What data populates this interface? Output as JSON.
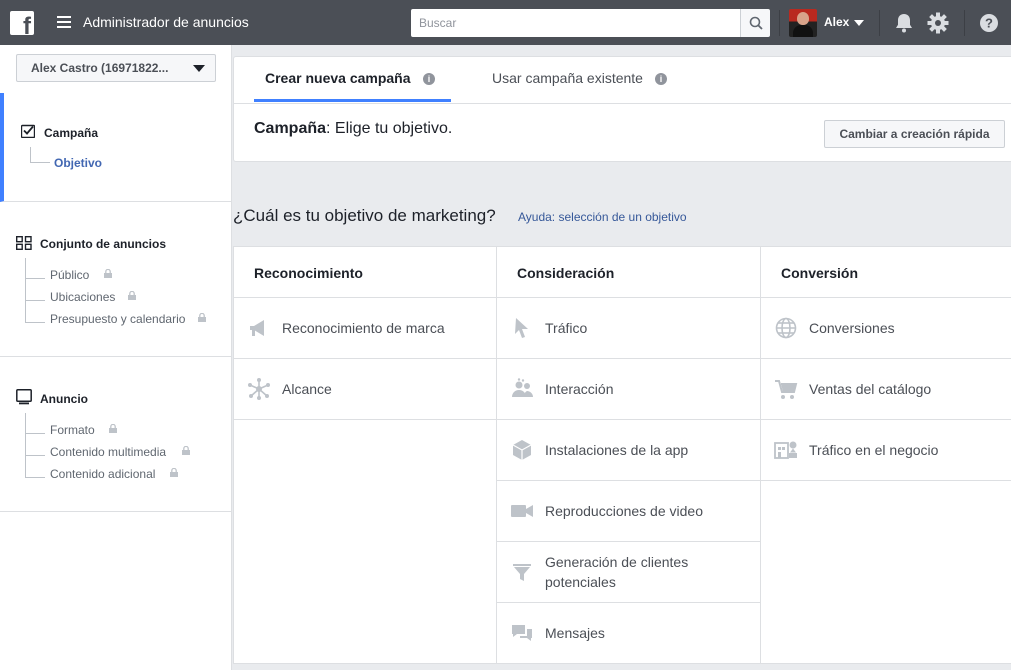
{
  "topbar": {
    "logo_letter": "f",
    "app_title": "Administrador de anuncios",
    "search_placeholder": "Buscar",
    "user_name": "Alex"
  },
  "sidebar": {
    "account": "Alex Castro (16971822...",
    "sections": [
      {
        "title": "Campaña",
        "icon": "checkbox-checked-icon",
        "items": [
          {
            "label": "Objetivo",
            "selected": true,
            "locked": false
          }
        ]
      },
      {
        "title": "Conjunto de anuncios",
        "icon": "grid-icon",
        "items": [
          {
            "label": "Público",
            "locked": true
          },
          {
            "label": "Ubicaciones",
            "locked": true
          },
          {
            "label": "Presupuesto y calendario",
            "locked": true
          }
        ]
      },
      {
        "title": "Anuncio",
        "icon": "monitor-icon",
        "items": [
          {
            "label": "Formato",
            "locked": true
          },
          {
            "label": "Contenido multimedia",
            "locked": true
          },
          {
            "label": "Contenido adicional",
            "locked": true
          }
        ]
      }
    ]
  },
  "panel": {
    "tabs": [
      {
        "label": "Crear nueva campaña",
        "active": true
      },
      {
        "label": "Usar campaña existente",
        "active": false
      }
    ],
    "title_bold": "Campaña",
    "title_rest": ": Elige tu objetivo.",
    "quick_button": "Cambiar a creación rápida"
  },
  "objective": {
    "question": "¿Cuál es tu objetivo de marketing?",
    "help_link": "Ayuda: selección de un objetivo",
    "columns": [
      {
        "title": "Reconocimiento",
        "items": [
          {
            "label": "Reconocimiento de marca",
            "icon": "megaphone-icon"
          },
          {
            "label": "Alcance",
            "icon": "network-icon"
          }
        ]
      },
      {
        "title": "Consideración",
        "items": [
          {
            "label": "Tráfico",
            "icon": "cursor-icon"
          },
          {
            "label": "Interacción",
            "icon": "people-icon"
          },
          {
            "label": "Instalaciones de la app",
            "icon": "box-icon"
          },
          {
            "label": "Reproducciones de video",
            "icon": "video-camera-icon"
          },
          {
            "label": "Generación de clientes potenciales",
            "icon": "funnel-icon"
          },
          {
            "label": "Mensajes",
            "icon": "chat-bubbles-icon"
          }
        ]
      },
      {
        "title": "Conversión",
        "items": [
          {
            "label": "Conversiones",
            "icon": "globe-icon"
          },
          {
            "label": "Ventas del catálogo",
            "icon": "cart-icon"
          },
          {
            "label": "Tráfico en el negocio",
            "icon": "store-icon"
          }
        ]
      }
    ]
  }
}
